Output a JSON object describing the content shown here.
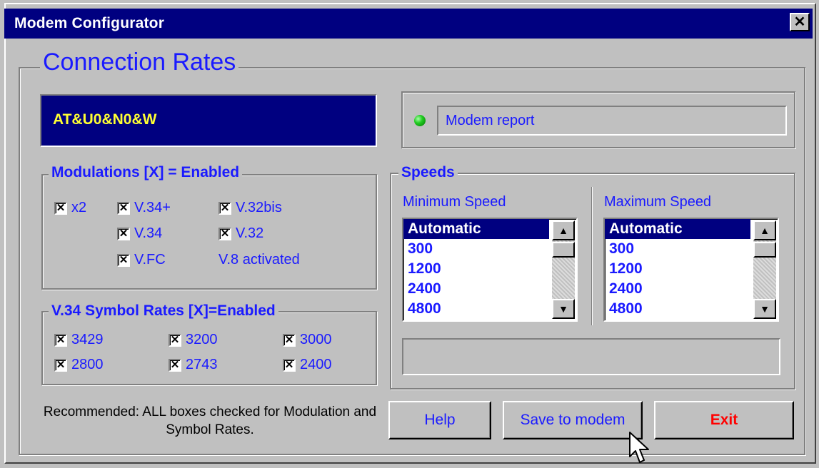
{
  "window": {
    "title": "Modem Configurator",
    "close_glyph": "✕"
  },
  "section_title": "Connection Rates",
  "command": "AT&U0&N0&W",
  "status": {
    "led_color": "#22cc22",
    "report": "Modem report"
  },
  "modulations": {
    "legend": "Modulations [X] = Enabled",
    "items": [
      {
        "label": "x2",
        "checked": true
      },
      {
        "label": "V.34+",
        "checked": true
      },
      {
        "label": "V.32bis",
        "checked": true
      },
      {
        "label": "V.34",
        "checked": true
      },
      {
        "label": "V.32",
        "checked": true
      },
      {
        "label": "V.FC",
        "checked": true
      }
    ],
    "v8_text": "V.8 activated"
  },
  "symbol_rates": {
    "legend": "V.34 Symbol Rates [X]=Enabled",
    "items": [
      {
        "label": "3429",
        "checked": true
      },
      {
        "label": "3200",
        "checked": true
      },
      {
        "label": "3000",
        "checked": true
      },
      {
        "label": "2800",
        "checked": true
      },
      {
        "label": "2743",
        "checked": true
      },
      {
        "label": "2400",
        "checked": true
      }
    ]
  },
  "speeds": {
    "legend": "Speeds",
    "min_label": "Minimum Speed",
    "max_label": "Maximum Speed",
    "min_options": [
      "Automatic",
      "300",
      "1200",
      "2400",
      "4800"
    ],
    "max_options": [
      "Automatic",
      "300",
      "1200",
      "2400",
      "4800"
    ],
    "min_selected": "Automatic",
    "max_selected": "Automatic"
  },
  "note": "Recommended: ALL boxes checked for Modulation and Symbol Rates.",
  "buttons": {
    "help": "Help",
    "save": "Save to modem",
    "exit": "Exit"
  },
  "colors": {
    "title_bar": "#000080",
    "accent_text": "#1a1aff",
    "exit_text": "#ff0000",
    "command_text": "#ffff33"
  }
}
